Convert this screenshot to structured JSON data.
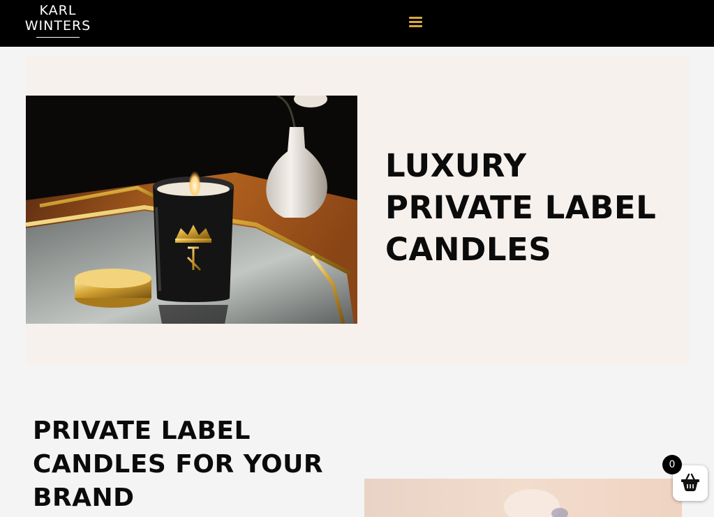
{
  "header": {
    "logo": {
      "line1": "KARL",
      "line2": "WINTERS"
    },
    "menu_icon": "hamburger-menu-icon",
    "menu_color": "#d9a93a"
  },
  "hero": {
    "title_lines": [
      "LUXURY",
      "PRIVATE LABEL",
      "CANDLES"
    ],
    "background": "#f6f1ed",
    "image": "black candle jar with gold crown YR logo on gold mirrored tray beside white vase"
  },
  "section2": {
    "title_lines": [
      "PRIVATE LABEL",
      "CANDLES FOR YOUR",
      "BRAND"
    ]
  },
  "cart": {
    "icon": "basket-icon",
    "count": "0"
  }
}
